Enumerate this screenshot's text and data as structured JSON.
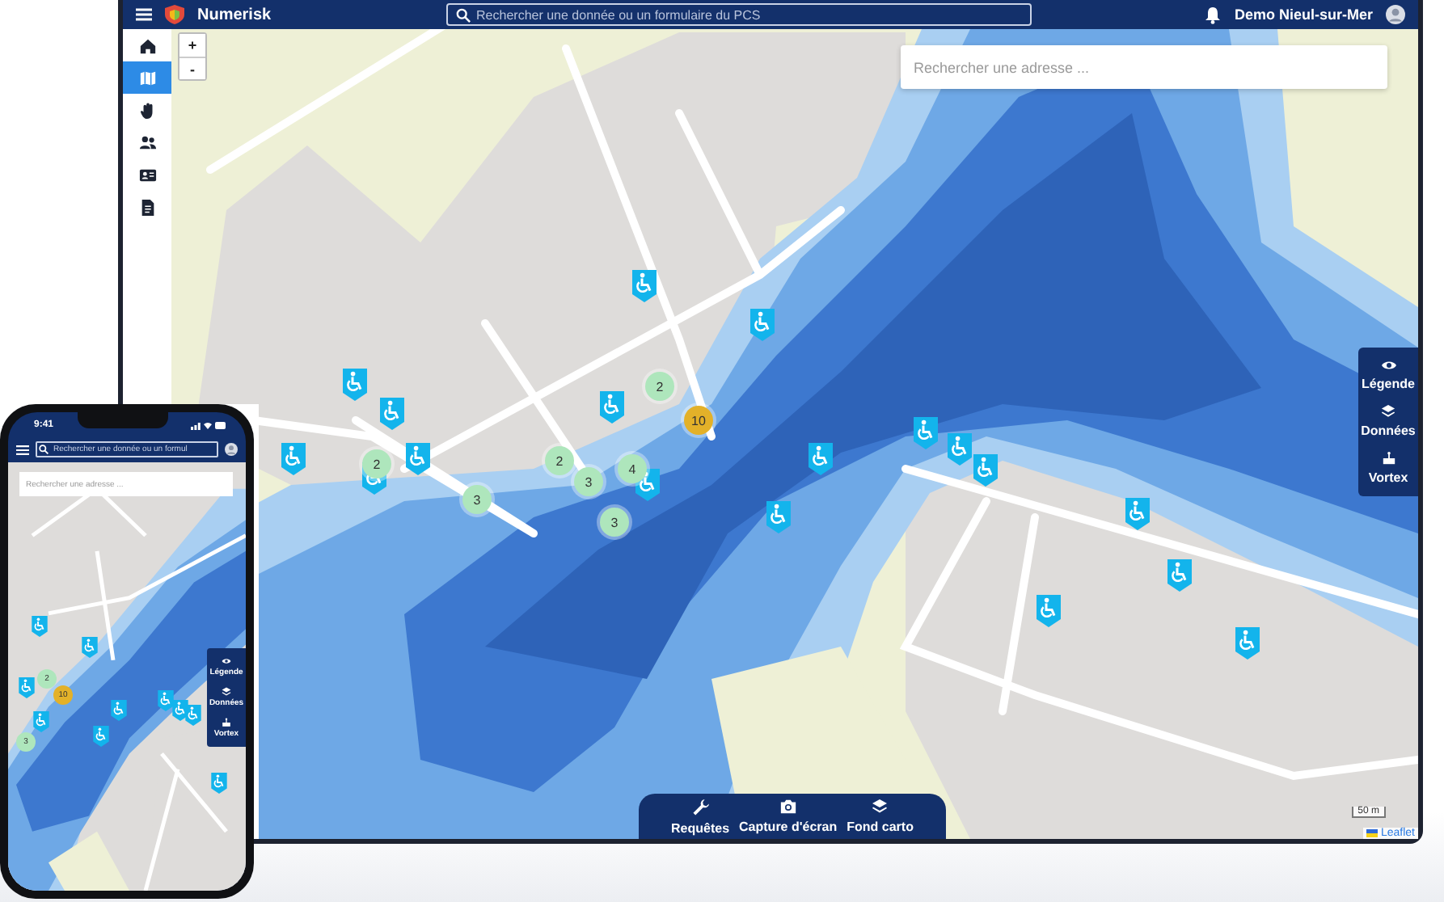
{
  "app": {
    "name": "Numerisk",
    "search_placeholder": "Rechercher une donnée ou un formulaire du PCS",
    "user": "Demo Nieul-sur-Mer"
  },
  "sidebar": {
    "items": [
      {
        "selected": false
      },
      {
        "selected": true
      },
      {
        "selected": false
      },
      {
        "selected": false
      },
      {
        "selected": false
      },
      {
        "selected": false
      }
    ]
  },
  "map": {
    "zoom_in": "+",
    "zoom_out": "-",
    "address_placeholder": "Rechercher une adresse ...",
    "panel": [
      {
        "label": "Légende"
      },
      {
        "label": "Données"
      },
      {
        "label": "Vortex"
      }
    ],
    "toolbar": [
      {
        "label": "Requêtes"
      },
      {
        "label": "Capture d'écran"
      },
      {
        "label": "Fond carto"
      }
    ],
    "clusters": [
      {
        "count": "2",
        "color": "#aee6bc"
      },
      {
        "count": "10",
        "color": "#e3b129"
      },
      {
        "count": "2",
        "color": "#aee6bc"
      },
      {
        "count": "3",
        "color": "#aee6bc"
      },
      {
        "count": "4",
        "color": "#aee6bc"
      },
      {
        "count": "3",
        "color": "#aee6bc"
      },
      {
        "count": "3",
        "color": "#aee6bc"
      },
      {
        "count": "2",
        "color": "#aee6bc"
      }
    ],
    "scale": "50 m",
    "attribution": "Leaflet"
  },
  "phone": {
    "time": "9:41",
    "search_placeholder": "Rechercher une donnée ou un formul",
    "address_placeholder": "Rechercher une adresse ...",
    "panel": [
      {
        "label": "Légende"
      },
      {
        "label": "Données"
      },
      {
        "label": "Vortex"
      }
    ],
    "clusters": [
      {
        "count": "2",
        "color": "#aee6bc"
      },
      {
        "count": "10",
        "color": "#e3b129"
      },
      {
        "count": "3",
        "color": "#aee6bc"
      }
    ]
  }
}
